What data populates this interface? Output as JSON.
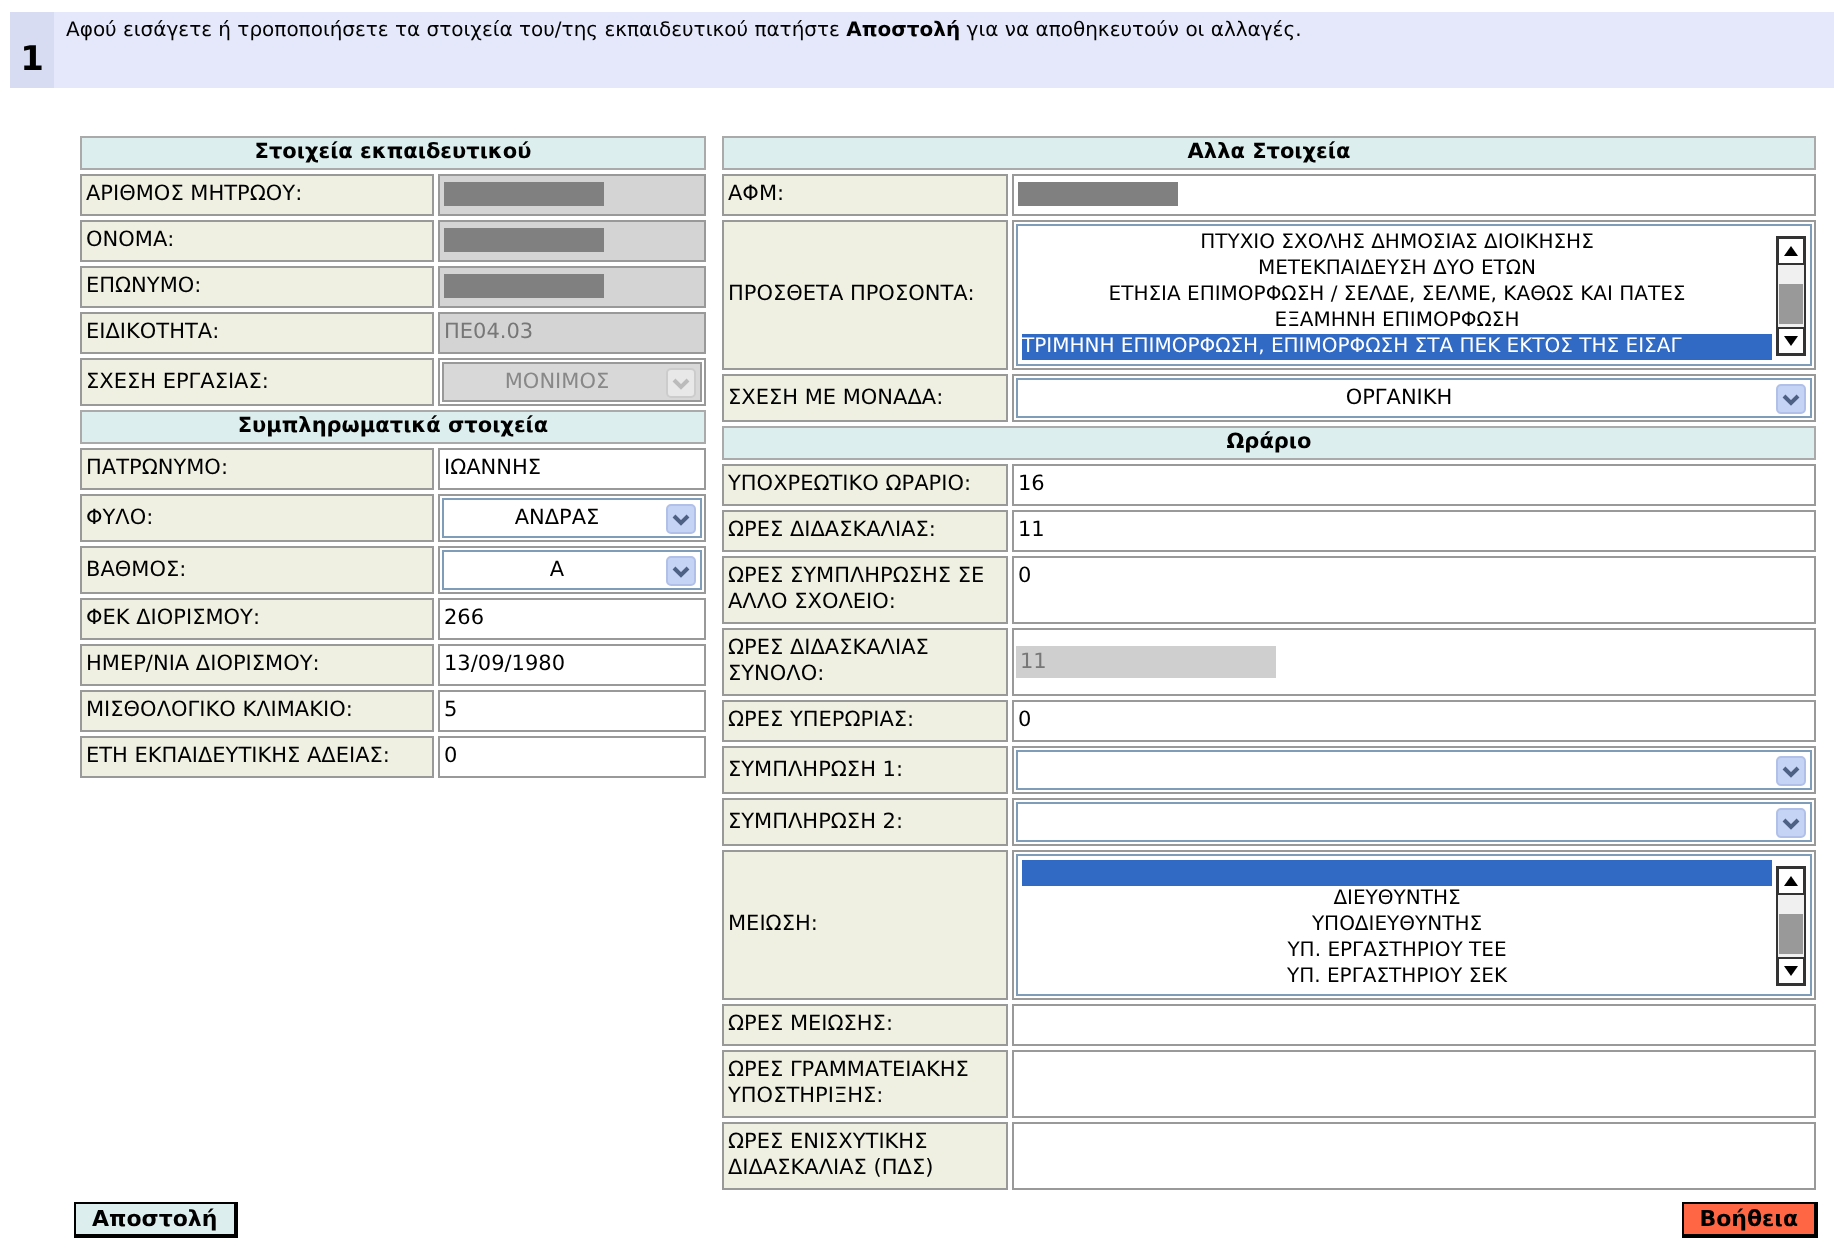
{
  "instruction": {
    "step": "1",
    "text": "Αφού εισάγετε ή τροποποιήσετε τα στοιχεία του/της εκπαιδευτικού πατήστε **Αποστολή** για να αποθηκευτούν οι αλλαγές."
  },
  "left_panel": {
    "sections": [
      {
        "title": "Στοιχεία εκπαιδευτικού",
        "rows": [
          {
            "label": "ΑΡΙΘΜΟΣ ΜΗΤΡΩΟΥ:",
            "kind": "redacted",
            "disabled": true
          },
          {
            "label": "ΟΝΟΜΑ:",
            "kind": "redacted",
            "disabled": true
          },
          {
            "label": "ΕΠΩΝΥΜΟ:",
            "kind": "redacted",
            "disabled": true
          },
          {
            "label": "ΕΙΔΙΚΟΤΗΤΑ:",
            "kind": "text",
            "value": "ΠΕ04.03",
            "disabled": true
          },
          {
            "label": "ΣΧΕΣΗ ΕΡΓΑΣΙΑΣ:",
            "kind": "select",
            "value": "ΜΟΝΙΜΟΣ",
            "disabled": true
          }
        ]
      },
      {
        "title": "Συμπληρωματικά στοιχεία",
        "rows": [
          {
            "label": "ΠΑΤΡΩΝΥΜΟ:",
            "kind": "text",
            "value": "ΙΩΑΝΝΗΣ",
            "disabled": false
          },
          {
            "label": "ΦΥΛΟ:",
            "kind": "select",
            "value": "ΑΝΔΡΑΣ",
            "disabled": false
          },
          {
            "label": "ΒΑΘΜΟΣ:",
            "kind": "select",
            "value": "Α",
            "disabled": false
          },
          {
            "label": "ΦΕΚ ΔΙΟΡΙΣΜΟΥ:",
            "kind": "text",
            "value": "266",
            "disabled": false
          },
          {
            "label": "ΗΜΕΡ/ΝΙΑ ΔΙΟΡΙΣΜΟΥ:",
            "kind": "text",
            "value": "13/09/1980",
            "disabled": false
          },
          {
            "label": "ΜΙΣΘΟΛΟΓΙΚΟ ΚΛΙΜΑΚΙΟ:",
            "kind": "text",
            "value": "5",
            "disabled": false
          },
          {
            "label": "ΕΤΗ ΕΚΠΑΙΔΕΥΤΙΚΗΣ ΑΔΕΙΑΣ:",
            "kind": "text",
            "value": "0",
            "disabled": false
          }
        ]
      }
    ]
  },
  "right_panel": {
    "sections": [
      {
        "title": "Αλλα Στοιχεία",
        "rows": [
          {
            "label": "ΑΦΜ:",
            "kind": "redacted",
            "disabled": false
          },
          {
            "label": "ΠΡΟΣΘΕΤΑ ΠΡΟΣΟΝΤΑ:",
            "kind": "listbox",
            "options": [
              {
                "text": "ΠΤΥΧΙΟ ΣΧΟΛΗΣ ΔΗΜΟΣΙΑΣ ΔΙΟΙΚΗΣΗΣ",
                "selected": false
              },
              {
                "text": "ΜΕΤΕΚΠΑΙΔΕΥΣΗ ΔΥΟ ΕΤΩΝ",
                "selected": false
              },
              {
                "text": "ΕΤΗΣΙΑ ΕΠΙΜΟΡΦΩΣΗ / ΣΕΛΔΕ, ΣΕΛΜΕ, ΚΑΘΩΣ ΚΑΙ ΠΑΤΕΣ",
                "selected": false
              },
              {
                "text": "ΕΞΑΜΗΝΗ ΕΠΙΜΟΡΦΩΣΗ",
                "selected": false
              },
              {
                "text": "ΤΡΙΜΗΝΗ ΕΠΙΜΟΡΦΩΣΗ, ΕΠΙΜΟΡΦΩΣΗ ΣΤΑ ΠΕΚ ΕΚΤΟΣ ΤΗΣ ΕΙΣΑΓ",
                "selected": true
              }
            ]
          },
          {
            "label": "ΣΧΕΣΗ ΜΕ ΜΟΝΑΔΑ:",
            "kind": "select",
            "value": "ΟΡΓΑΝΙΚΗ",
            "disabled": false
          }
        ]
      },
      {
        "title": "Ωράριο",
        "rows": [
          {
            "label": "ΥΠΟΧΡΕΩΤΙΚΟ ΩΡΑΡΙΟ:",
            "kind": "text",
            "value": "16",
            "disabled": false
          },
          {
            "label": "ΩΡΕΣ ΔΙΔΑΣΚΑΛΙΑΣ:",
            "kind": "text",
            "value": "11",
            "disabled": false
          },
          {
            "label": "ΩΡΕΣ ΣΥΜΠΛΗΡΩΣΗΣ ΣΕ ΑΛΛΟ ΣΧΟΛΕΙΟ:",
            "kind": "text",
            "value": "0",
            "disabled": false
          },
          {
            "label": "ΩΡΕΣ ΔΙΔΑΣΚΑΛΙΑΣ ΣΥΝΟΛΟ:",
            "kind": "short",
            "value": "11",
            "disabled": true
          },
          {
            "label": "ΩΡΕΣ ΥΠΕΡΩΡΙΑΣ:",
            "kind": "text",
            "value": "0",
            "disabled": false
          },
          {
            "label": "ΣΥΜΠΛΗΡΩΣΗ 1:",
            "kind": "select",
            "disabled": false
          },
          {
            "label": "ΣΥΜΠΛΗΡΩΣΗ 2:",
            "kind": "select",
            "disabled": false
          },
          {
            "label": "ΜΕΙΩΣΗ:",
            "kind": "listbox",
            "options": [
              {
                "selected": true
              },
              {
                "text": "ΔΙΕΥΘΥΝΤΗΣ",
                "selected": false
              },
              {
                "text": "ΥΠΟΔΙΕΥΘΥΝΤΗΣ",
                "selected": false
              },
              {
                "text": "ΥΠ. ΕΡΓΑΣΤΗΡΙΟΥ ΤΕΕ",
                "selected": false
              },
              {
                "text": "ΥΠ. ΕΡΓΑΣΤΗΡΙΟΥ ΣΕΚ",
                "selected": false
              }
            ]
          },
          {
            "label": "ΩΡΕΣ ΜΕΙΩΣΗΣ:",
            "kind": "text",
            "disabled": false
          },
          {
            "label": "ΩΡΕΣ ΓΡΑΜΜΑΤΕΙΑΚΗΣ ΥΠΟΣΤΗΡΙΞΗΣ:",
            "kind": "text",
            "disabled": false
          },
          {
            "label": "ΩΡΕΣ ΕΝΙΣΧΥΤΙΚΗΣ ΔΙΔΑΣΚΑΛΙΑΣ (ΠΔΣ)",
            "kind": "text",
            "disabled": false
          }
        ]
      }
    ]
  },
  "buttons": [
    {
      "label": "Αποστολή",
      "kind": "submit"
    },
    {
      "label": "Βοήθεια",
      "kind": "help"
    }
  ]
}
